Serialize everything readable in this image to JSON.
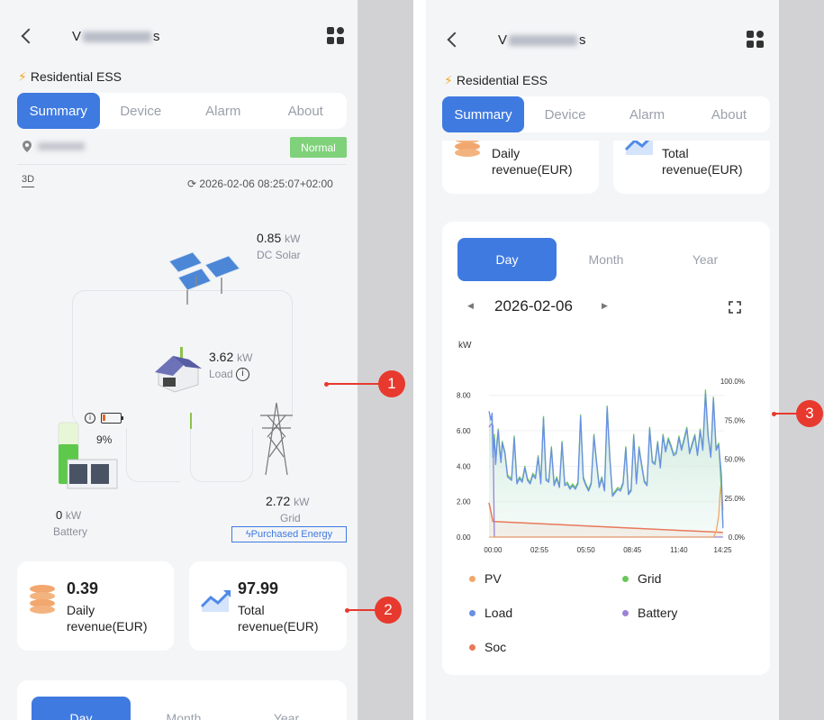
{
  "header": {
    "user_prefix": "V",
    "user_suffix": "s",
    "site_name": "Residential ESS"
  },
  "tabs": [
    "Summary",
    "Device",
    "Alarm",
    "About"
  ],
  "status": {
    "badge": "Normal",
    "view_mode": "3D",
    "timestamp": "2026-02-06 08:25:07+02:00"
  },
  "energy_flow": {
    "solar": {
      "value": "0.85",
      "unit": "kW",
      "label": "DC Solar"
    },
    "load": {
      "value": "3.62",
      "unit": "kW",
      "label": "Load"
    },
    "battery": {
      "value": "0",
      "unit": "kW",
      "label": "Battery",
      "soc": "9%"
    },
    "grid": {
      "value": "2.72",
      "unit": "kW",
      "label": "Grid",
      "tag": "Purchased Energy"
    }
  },
  "revenue": {
    "daily": {
      "value": "0.39",
      "label": "Daily revenue(EUR)"
    },
    "total": {
      "value": "97.99",
      "label": "Total revenue(EUR)"
    }
  },
  "period_tabs": [
    "Day",
    "Month",
    "Year"
  ],
  "chart_nav": {
    "date": "2026-02-06"
  },
  "callouts": [
    "1",
    "2",
    "3"
  ],
  "chart_data": {
    "type": "line",
    "ylabel": "kW",
    "ylim": [
      0,
      8.8
    ],
    "y2lim": [
      0,
      100
    ],
    "y_ticks": [
      "0.00",
      "2.00",
      "4.00",
      "6.00",
      "8.00"
    ],
    "y2_ticks": [
      "0.0%",
      "25.0%",
      "50.0%",
      "75.0%",
      "100.0%"
    ],
    "x_ticks": [
      "00:00",
      "02:55",
      "05:50",
      "08:45",
      "11:40",
      "14:25"
    ],
    "x_tick_minutes": [
      0,
      175,
      350,
      525,
      700,
      865
    ],
    "xlim_minutes": [
      -15,
      870
    ],
    "legend": [
      "PV",
      "Grid",
      "Load",
      "Battery",
      "Soc"
    ],
    "colors": {
      "PV": "#f0a86a",
      "Grid": "#6bc75c",
      "Load": "#6a8fe6",
      "Battery": "#9b83d6",
      "Soc": "#e8795a"
    },
    "series": [
      {
        "name": "Load",
        "x": [
          -15,
          -8,
          -3,
          0,
          5,
          10,
          15,
          20,
          25,
          30,
          35,
          45,
          55,
          70,
          80,
          90,
          100,
          110,
          120,
          130,
          140,
          150,
          160,
          170,
          180,
          190,
          200,
          210,
          220,
          230,
          240,
          250,
          260,
          270,
          280,
          290,
          300,
          310,
          320,
          330,
          340,
          350,
          360,
          370,
          380,
          390,
          400,
          410,
          420,
          430,
          440,
          450,
          460,
          470,
          480,
          490,
          500,
          510,
          520,
          530,
          540,
          550,
          560,
          570,
          580,
          590,
          600,
          610,
          620,
          630,
          640,
          650,
          660,
          670,
          680,
          690,
          700,
          710,
          720,
          730,
          740,
          750,
          760,
          770,
          780,
          790,
          800,
          810,
          820,
          830,
          840,
          850,
          860,
          866
        ],
        "y": [
          7.1,
          6.6,
          7.0,
          4.5,
          5.6,
          4.1,
          5.2,
          6.0,
          4.9,
          4.2,
          5.3,
          4.7,
          3.4,
          3.2,
          5.6,
          3.0,
          3.3,
          3.1,
          3.9,
          3.2,
          3.0,
          3.5,
          3.3,
          4.5,
          3.0,
          6.7,
          3.2,
          3.1,
          5.0,
          2.9,
          3.3,
          2.8,
          5.3,
          2.9,
          3.0,
          2.7,
          2.9,
          2.7,
          3.0,
          6.8,
          3.3,
          2.9,
          2.6,
          3.0,
          5.7,
          4.2,
          2.8,
          3.3,
          2.6,
          7.3,
          4.4,
          2.3,
          2.5,
          2.7,
          2.6,
          3.0,
          5.0,
          2.4,
          2.6,
          5.7,
          3.0,
          5.0,
          4.0,
          3.1,
          2.9,
          6.1,
          4.2,
          4.1,
          5.3,
          3.9,
          5.7,
          4.8,
          5.5,
          5.1,
          4.6,
          4.7,
          5.6,
          4.9,
          5.5,
          6.1,
          4.7,
          5.2,
          5.7,
          4.6,
          6.0,
          4.9,
          8.1,
          5.7,
          4.5,
          7.8,
          4.9,
          5.2,
          3.5,
          0.5
        ]
      },
      {
        "name": "Grid",
        "x": [
          0,
          5,
          10,
          15,
          20,
          25,
          30,
          35,
          45,
          55,
          70,
          80,
          90,
          100,
          110,
          120,
          130,
          140,
          150,
          160,
          170,
          180,
          190,
          200,
          210,
          220,
          230,
          240,
          250,
          260,
          270,
          280,
          290,
          300,
          310,
          320,
          330,
          340,
          350,
          360,
          370,
          380,
          390,
          400,
          410,
          420,
          430,
          440,
          450,
          460,
          470,
          480,
          490,
          500,
          510,
          520,
          530,
          540,
          550,
          560,
          570,
          580,
          590,
          600,
          610,
          620,
          630,
          640,
          650,
          660,
          670,
          680,
          690,
          700,
          710,
          720,
          730,
          740,
          750,
          760,
          770,
          780,
          790,
          800,
          810,
          820,
          830,
          840,
          850,
          860,
          866
        ],
        "y": [
          4.7,
          5.8,
          4.2,
          5.4,
          6.1,
          5.0,
          4.4,
          5.4,
          4.8,
          3.5,
          3.3,
          5.7,
          3.1,
          3.4,
          3.2,
          4.0,
          3.3,
          3.1,
          3.6,
          3.4,
          4.6,
          3.1,
          6.8,
          3.3,
          3.2,
          5.1,
          3.0,
          3.4,
          2.9,
          5.4,
          3.0,
          3.1,
          2.8,
          3.0,
          2.8,
          3.1,
          6.9,
          3.4,
          3.0,
          2.7,
          3.1,
          5.8,
          4.3,
          2.9,
          3.4,
          2.7,
          7.4,
          4.5,
          2.4,
          2.6,
          2.8,
          2.7,
          3.1,
          5.1,
          2.5,
          2.7,
          5.8,
          3.1,
          5.1,
          4.1,
          3.2,
          3.0,
          6.2,
          4.3,
          4.2,
          5.4,
          4.0,
          5.8,
          4.9,
          5.6,
          5.2,
          4.7,
          4.8,
          5.7,
          5.0,
          5.6,
          6.2,
          4.8,
          5.3,
          5.8,
          4.7,
          6.1,
          5.0,
          8.3,
          5.8,
          4.6,
          7.9,
          5.0,
          5.3,
          2.6,
          0.6
        ]
      },
      {
        "name": "PV",
        "x": [
          -15,
          820,
          830,
          840,
          850,
          855,
          860,
          866
        ],
        "y": [
          0,
          0,
          0,
          0.3,
          1.2,
          2.5,
          3.2,
          1.5
        ]
      },
      {
        "name": "Battery",
        "x": [
          -15,
          -10,
          -5,
          0,
          5,
          866
        ],
        "y": [
          6.2,
          6.3,
          6.4,
          6.3,
          0,
          0
        ]
      },
      {
        "name": "Soc",
        "x": [
          -15,
          0,
          5,
          860,
          866
        ],
        "y": [
          22,
          10,
          10,
          3,
          3
        ]
      }
    ]
  }
}
